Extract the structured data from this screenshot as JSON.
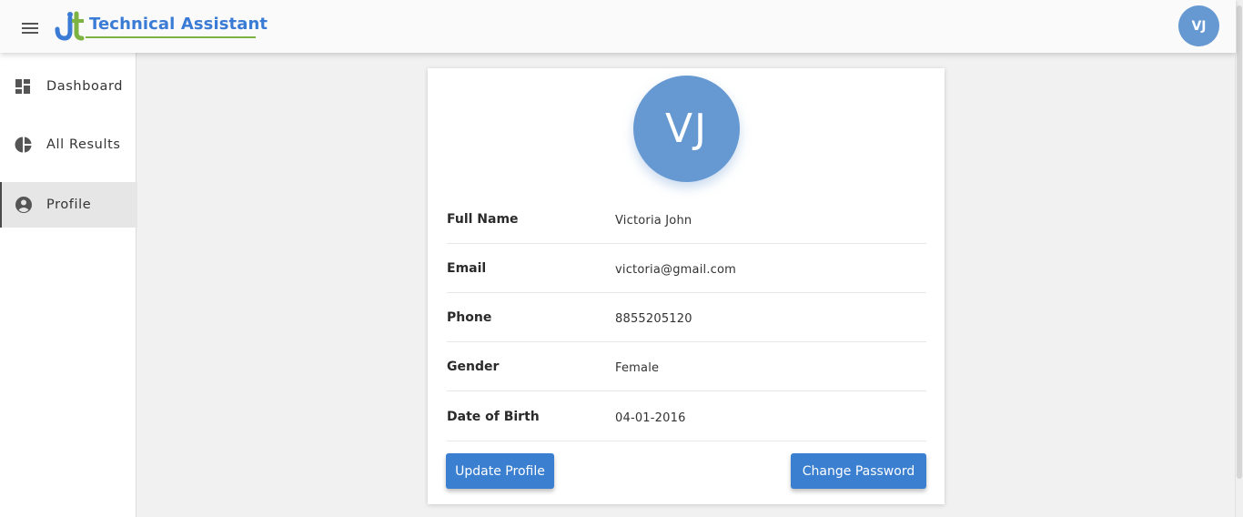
{
  "header": {
    "brand": "Technical Assistant",
    "user_initials": "VJ",
    "menu_icon": "hamburger-menu-icon",
    "logo_icon": "jt-logo-icon"
  },
  "sidebar": {
    "items": [
      {
        "label": "Dashboard",
        "icon": "dashboard-icon",
        "active": false
      },
      {
        "label": "All Results",
        "icon": "pie-chart-icon",
        "active": false
      },
      {
        "label": "Profile",
        "icon": "account-circle-icon",
        "active": true
      }
    ]
  },
  "profile": {
    "initials": "VJ",
    "fields": [
      {
        "label": "Full Name",
        "value": "Victoria John"
      },
      {
        "label": "Email",
        "value": "victoria@gmail.com"
      },
      {
        "label": "Phone",
        "value": "8855205120"
      },
      {
        "label": "Gender",
        "value": "Female"
      },
      {
        "label": "Date of Birth",
        "value": "04-01-2016"
      }
    ],
    "update_button": "Update Profile",
    "change_password_button": "Change Password"
  },
  "colors": {
    "accent": "#3a7fd0",
    "avatar": "#6699d2",
    "logo_green": "#7cb342",
    "brand_blue": "#3a7bd5"
  }
}
